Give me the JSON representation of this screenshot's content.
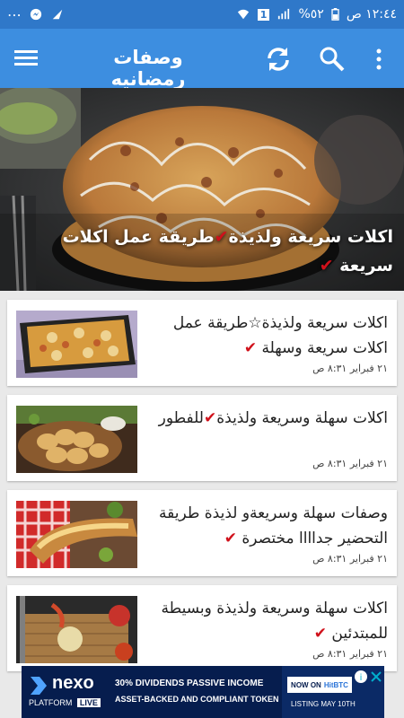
{
  "status_bar": {
    "time": "١٢:٤٤ ص",
    "battery": "%٥٢",
    "network": "1"
  },
  "app_bar": {
    "title": "وصفات رمضانيه",
    "icons": [
      "menu-icon",
      "refresh-icon",
      "search-icon",
      "more-icon"
    ]
  },
  "featured": {
    "title": "اكلات سريعة ولذيذة",
    "title_part2": "طريقة عمل اكلات سريعة",
    "check": "✔"
  },
  "articles": [
    {
      "title_a": "اكلات سريعة ولذيذة☆طريقة عمل اكلات سريعة وسهلة",
      "check": "✔",
      "date": "٢١ فبراير ٨:٣١ ص"
    },
    {
      "title_a": "اكلات سهلة وسريعة ولذيذة",
      "title_b": "للفطور",
      "check": "✔",
      "date": "٢١ فبراير ٨:٣١ ص"
    },
    {
      "title_a": "وصفات سهلة وسريعةو لذيذة طريقة التحضير جداااا مختصرة",
      "check": "✔",
      "date": "٢١ فبراير ٨:٣١ ص"
    },
    {
      "title_a": "اكلات سهلة وسريعة ولذيذة وبسيطة للمبتدئين",
      "check": "✔",
      "date": "٢١ فبراير ٨:٣١ ص"
    }
  ],
  "ad": {
    "brand": "nexo",
    "platform": "PLATFORM",
    "live": "LIVE",
    "line1": "30% DIVIDENDS PASSIVE INCOME",
    "line2": "ASSET-BACKED AND COMPLIANT TOKEN",
    "now_on": "NOW ON",
    "exchange": "HitBTC",
    "listing": "LISTING MAY 10TH"
  },
  "colors": {
    "status_bar": "#2f78c9",
    "app_bar": "#3d8ee0",
    "check": "#d0111b",
    "background": "#e9e9e9"
  }
}
